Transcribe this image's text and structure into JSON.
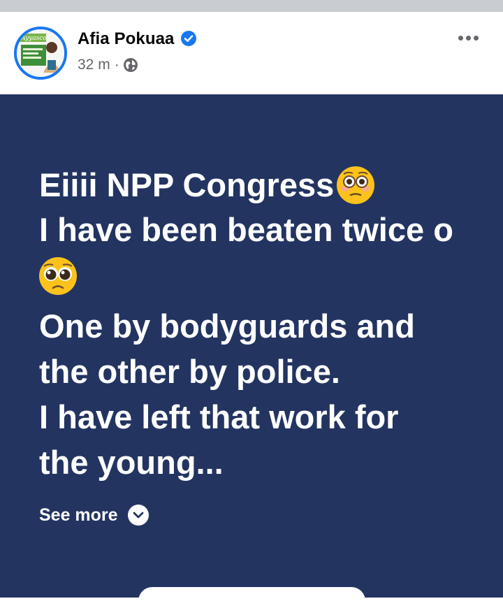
{
  "post": {
    "author": "Afia Pokuaa",
    "time": "32 m",
    "separator": "·",
    "avatar_caption": "Ayyasco",
    "lines": [
      "Eiiii NPP Congress",
      "I have been beaten twice o",
      "",
      "One by bodyguards and",
      "the other by police.",
      "I have left that work for",
      "the young..."
    ],
    "see_more": "See more"
  },
  "icons": {
    "verified": "verified-badge-icon",
    "audience": "globe-icon",
    "more": "more-options-icon",
    "emoji_1": "flushed-face-emoji",
    "emoji_2": "pleading-face-emoji",
    "see_more": "chevron-down-icon"
  },
  "colors": {
    "post_background": "#233461",
    "verified": "#1877f2",
    "secondary_text": "#65676b"
  }
}
